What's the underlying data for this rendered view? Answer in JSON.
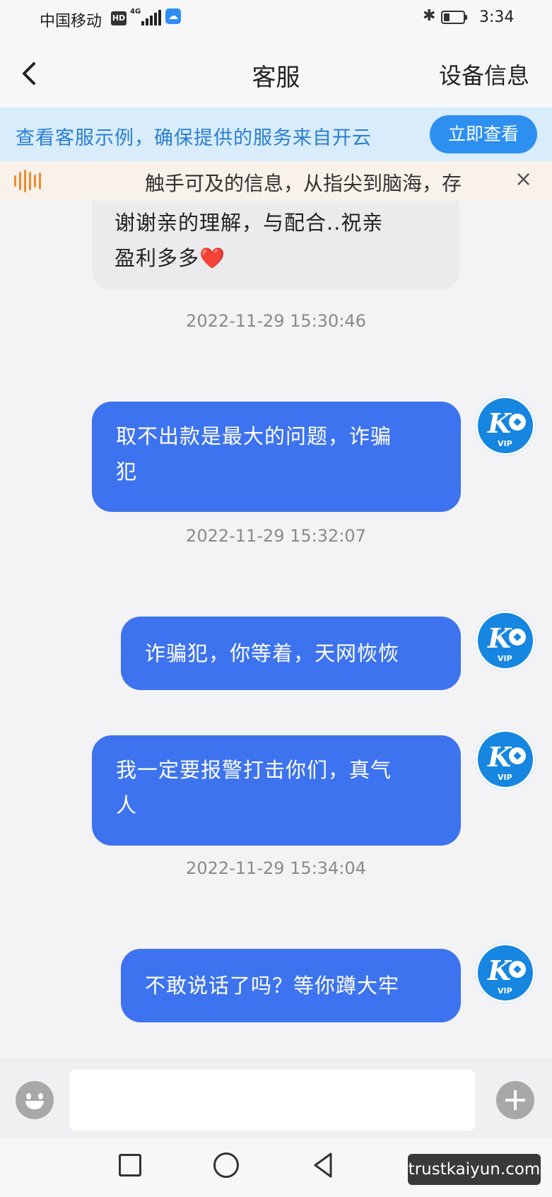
{
  "status_bar": {
    "carrier": "中国移动",
    "hd": "HD",
    "network": "4G",
    "time": "3:34"
  },
  "header": {
    "title": "客服",
    "device_info": "设备信息"
  },
  "banner": {
    "text": "查看客服示例，确保提供的服务来自开云",
    "button": "立即查看"
  },
  "marquee": {
    "text": "触手可及的信息，从指尖到脑海，存"
  },
  "messages": {
    "m1_line1": "谢谢亲的理解，与配合..祝亲",
    "m1_line2": "盈利多多❤️",
    "ts1": "2022-11-29 15:30:46",
    "m2_line1": "取不出款是最大的问题，诈骗",
    "m2_line2": "犯",
    "ts2": "2022-11-29 15:32:07",
    "m3": "诈骗犯，你等着，天网恢恢",
    "m4_line1": "我一定要报警打击你们，真气",
    "m4_line2": "人",
    "ts3": "2022-11-29 15:34:04",
    "m5": "不敢说话了吗？等你蹲大牢"
  },
  "avatar": {
    "letter": "K",
    "badge": "VIP"
  },
  "watermark": "trustkaiyun.com",
  "icons": [
    "back-arrow-icon",
    "bluetooth-icon",
    "battery-icon",
    "sound-wave-icon",
    "close-icon",
    "emoji-icon",
    "plus-icon",
    "nav-square-icon",
    "nav-circle-icon",
    "nav-back-icon"
  ],
  "colors": {
    "outgoing_bubble": "#3d73ee",
    "banner_bg": "#d8ecfb",
    "banner_button": "#2d8ff0",
    "marquee_wave": "#f08a2c"
  }
}
